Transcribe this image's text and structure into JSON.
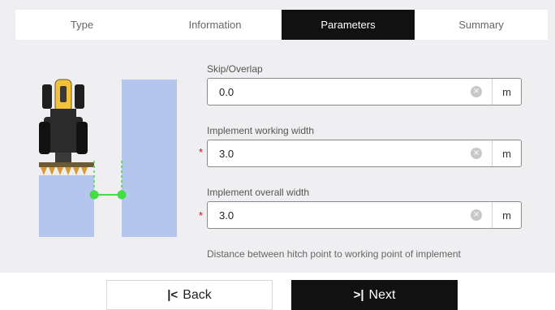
{
  "tabs": [
    "Type",
    "Information",
    "Parameters",
    "Summary"
  ],
  "active_tab": "Parameters",
  "fields": [
    {
      "label": "Skip/Overlap",
      "value": "0.0",
      "unit": "m",
      "required": false
    },
    {
      "label": "Implement working width",
      "value": "3.0",
      "unit": "m",
      "required": true
    },
    {
      "label": "Implement overall width",
      "value": "3.0",
      "unit": "m",
      "required": true
    }
  ],
  "required_mark": "*",
  "hint": "Distance between hitch point to working point of implement",
  "buttons": {
    "back_label": "Back",
    "next_label": "Next"
  },
  "colors": {
    "active_tab_bg": "#111111",
    "coverage_area": "#b4c6ee",
    "measure_line": "#44dd44",
    "required": "#d0021b"
  }
}
